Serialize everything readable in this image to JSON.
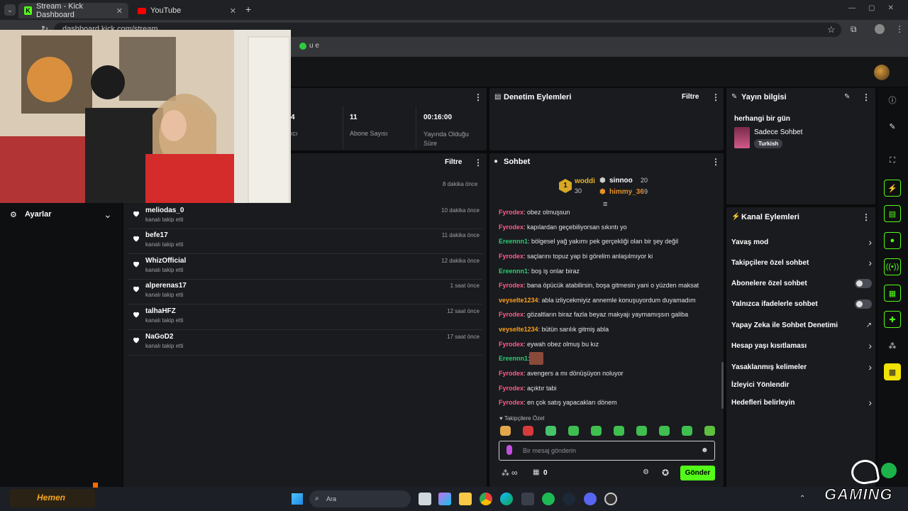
{
  "browser": {
    "tabs": [
      {
        "label": "Stream - Kick Dashboard",
        "active": true
      },
      {
        "label": "YouTube",
        "active": false
      }
    ],
    "new_tab": "+",
    "url": "dashboard.kick.com/stream",
    "bookmark": "u e"
  },
  "stats": {
    "items": [
      {
        "value": "4",
        "label": "ıcı"
      },
      {
        "value": "11",
        "label": "Abone Sayısı"
      },
      {
        "value": "00:16:00",
        "label": "Yayında Olduğu Süre"
      }
    ]
  },
  "activity": {
    "filter_label": "Filtre",
    "first_time": "8 dakika önce",
    "followers": [
      {
        "name": "meliodas_0",
        "sub": "kanalı takip etti",
        "time": "10 dakika önce"
      },
      {
        "name": "befe17",
        "sub": "kanalı takip etti",
        "time": "11 dakika önce"
      },
      {
        "name": "WhizOfficial",
        "sub": "kanalı takip etti",
        "time": "12 dakika önce"
      },
      {
        "name": "alperenas17",
        "sub": "kanalı takip etti",
        "time": "1 saat önce"
      },
      {
        "name": "talhaHFZ",
        "sub": "kanalı takip etti",
        "time": "12 saat önce"
      },
      {
        "name": "NaGoD2",
        "sub": "kanalı takip etti",
        "time": "17 saat önce"
      }
    ]
  },
  "sidebar": {
    "settings_label": "Ayarlar"
  },
  "moderation": {
    "title": "Denetim Eylemleri",
    "filter_label": "Filtre"
  },
  "chat": {
    "title": "Sohbet",
    "leaderboard": [
      {
        "rank": "1",
        "name": "woddi",
        "value": "30"
      },
      {
        "rank": "",
        "name": "sinnoo",
        "value": "20"
      },
      {
        "rank": "",
        "name": "himmy_36",
        "value": "9"
      }
    ],
    "messages": [
      {
        "user": "Fyrodex",
        "color": "#ff5c8a",
        "text": ": obez olmuşsun"
      },
      {
        "user": "Fyrodex",
        "color": "#ff5c8a",
        "text": ": kapılardan geçebiliyorsan sıkıntı yo"
      },
      {
        "user": "Ereennn1",
        "color": "#2ecc71",
        "text": ": bölgesel yağ yakımı pek gerçekliği olan bir şey değil"
      },
      {
        "user": "Fyrodex",
        "color": "#ff5c8a",
        "text": ": saçlarını topuz yap bi görelim anlaşılmıyor ki"
      },
      {
        "user": "Ereennn1",
        "color": "#2ecc71",
        "text": ": boş iş onlar biraz"
      },
      {
        "user": "Fyrodex",
        "color": "#ff5c8a",
        "text": ": bana öpücük atabilirsin, boşa gitmesin yani o yüzden maksat"
      },
      {
        "user": "veyselte1234",
        "color": "#ff9f1a",
        "text": ": abla izliycekmiyiz annemle konuşuyordum duyamadım"
      },
      {
        "user": "Fyrodex",
        "color": "#ff5c8a",
        "text": ": gözaltların biraz fazla beyaz makyajı yaymamışsın galiba"
      },
      {
        "user": "veyselte1234",
        "color": "#ff9f1a",
        "text": ": bütün sarılık gitmiş abla"
      },
      {
        "user": "Fyrodex",
        "color": "#ff5c8a",
        "text": ": eywah obez olmuş bu kız"
      },
      {
        "user": "Ereennn1",
        "color": "#2ecc71",
        "text": ":"
      },
      {
        "user": "Fyrodex",
        "color": "#ff5c8a",
        "text": ": avengers a mı dönüşüyon noluyor"
      },
      {
        "user": "Fyrodex",
        "color": "#ff5c8a",
        "text": ": açıktır tabi"
      },
      {
        "user": "Fyrodex",
        "color": "#ff5c8a",
        "text": ": en çok satış yapacakları dönem"
      }
    ],
    "emote_section": "Takipçilere Özel",
    "input_placeholder": "Bir mesaj gönderin",
    "store_count": "0",
    "infinity": "∞",
    "send_label": "Gönder"
  },
  "stream_info": {
    "title": "Yayın bilgisi",
    "stream_title": "herhangi bir gün",
    "category": "Sadece Sohbet",
    "language": "Turkish"
  },
  "channel_actions": {
    "title": "Kanal Eylemleri",
    "items": [
      {
        "label": "Yavaş mod",
        "control": "chevron"
      },
      {
        "label": "Takipçilere özel sohbet",
        "control": "chevron"
      },
      {
        "label": "Abonelere özel sohbet",
        "control": "toggle"
      },
      {
        "label": "Yalnızca ifadelerle sohbet",
        "control": "toggle"
      },
      {
        "label": "Yapay Zeka ile Sohbet Denetimi",
        "control": "external"
      },
      {
        "label": "Hesap yaşı kısıtlaması",
        "control": "chevron"
      },
      {
        "label": "Yasaklanmış kelimeler",
        "control": "chevron"
      },
      {
        "label": "İzleyici Yönlendir",
        "control": "none"
      },
      {
        "label": "Hedefleri belirleyin",
        "control": "chevron"
      }
    ]
  },
  "taskbar": {
    "search_placeholder": "Ara",
    "widget_label": "Hemen"
  },
  "watermark": {
    "text": "GAMING"
  },
  "colors": {
    "kick_green": "#53fc18",
    "panel": "#191b1f",
    "bg": "#0b0b0c"
  }
}
